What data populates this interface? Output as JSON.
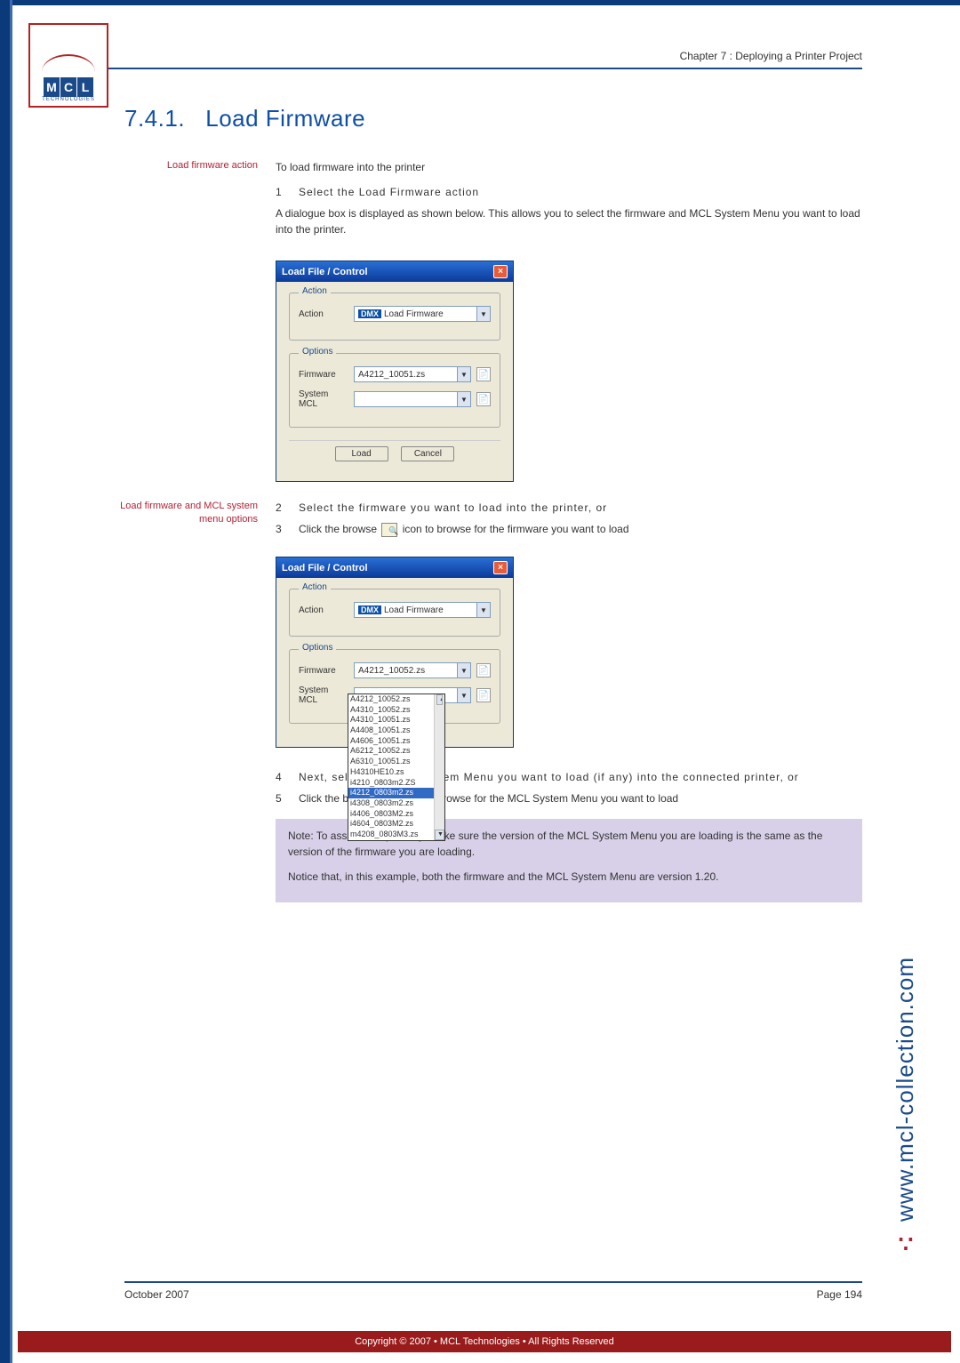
{
  "header": {
    "chapter": "Chapter 7 : Deploying a Printer Project"
  },
  "section": {
    "number": "7.4.1.",
    "title": "Load Firmware"
  },
  "margin_labels": {
    "action": "Load firmware action",
    "options": "Load firmware and MCL system menu options"
  },
  "body": {
    "intro": "To load firmware into the printer",
    "step1": "Select the Load Firmware action",
    "dialog_intro": "A dialogue box is displayed as shown below. This allows you to select the firmware and MCL System Menu you want to load into the printer.",
    "step2": "Select the firmware you want to load into the printer, or",
    "step3_a": "Click the browse",
    "step3_b": "icon to browse for the firmware you want to load",
    "step4": "Next, select the MCL System Menu you want to load (if any) into the connected printer, or",
    "step5_a": "Click the browse",
    "step5_b": "icon to browse for the MCL System Menu you want to load"
  },
  "note": {
    "p1": "Note: To assure compatibility, make sure the version of the MCL System Menu you are loading is the same as the version of the firmware you are loading.",
    "p2": "Notice that, in this example, both the firmware and the MCL System Menu are version 1.20."
  },
  "dialog1": {
    "title": "Load File / Control",
    "group_action": "Action",
    "label_action": "Action",
    "action_value": "Load Firmware",
    "dmx": "DMX",
    "group_options": "Options",
    "label_firmware": "Firmware",
    "firmware_value": "A4212_10051.zs",
    "label_system": "System MCL",
    "system_value": "",
    "btn_load": "Load",
    "btn_cancel": "Cancel"
  },
  "dialog2": {
    "title": "Load File / Control",
    "group_action": "Action",
    "label_action": "Action",
    "action_value": "Load Firmware",
    "dmx": "DMX",
    "group_options": "Options",
    "label_firmware": "Firmware",
    "firmware_value": "A4212_10052.zs",
    "label_system": "System MCL",
    "dropdown_items": [
      "A4212_10052.zs",
      "A4310_10052.zs",
      "A4310_10051.zs",
      "A4408_10051.zs",
      "A4606_10051.zs",
      "A6212_10052.zs",
      "A6310_10051.zs",
      "H4310HE10.zs",
      "i4210_0803m2.ZS",
      "i4212_0803m2.zs",
      "i4308_0803m2.zs",
      "i4406_0803M2.zs",
      "i4604_0803M2.zs",
      "m4208_0803M3.zs"
    ],
    "selected_index": 9
  },
  "footer": {
    "date": "October 2007",
    "page": "Page 194",
    "copyright": "Copyright © 2007 • MCL Technologies • All Rights Reserved",
    "url": "www.mcl-collection.com"
  },
  "nums": {
    "n1": "1",
    "n2": "2",
    "n3": "3",
    "n4": "4",
    "n5": "5"
  }
}
